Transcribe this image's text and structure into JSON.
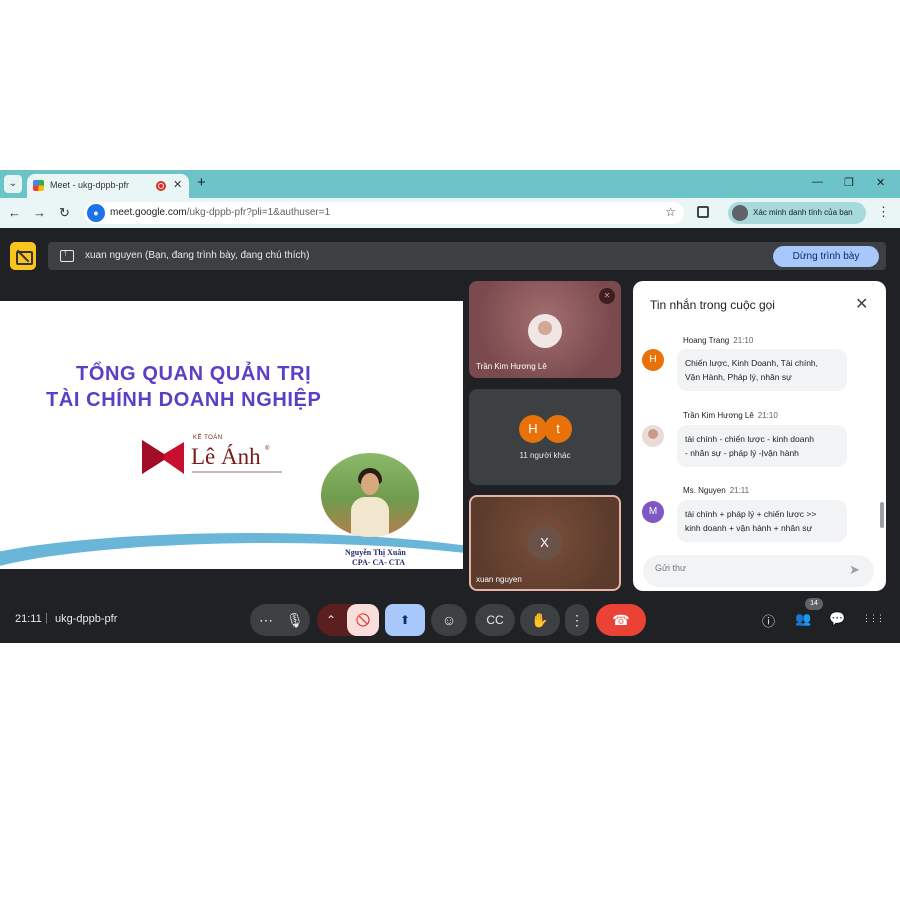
{
  "browser": {
    "tab_title": "Meet - ukg-dppb-pfr",
    "tab_close": "✕",
    "new_tab": "+",
    "url_host": "meet.google.com",
    "url_path": "/ukg-dppb-pfr?pli=1&authuser=1",
    "profile_chip": "Xác minh danh tính của bạn",
    "window_controls": [
      "—",
      "❐",
      "✕"
    ]
  },
  "presenting_bar": {
    "text": "xuan nguyen (Bạn, đang trình bày, đang chú thích)",
    "stop_button": "Dừng trình bày"
  },
  "slide": {
    "title_line1": "TỔNG QUAN QUẢN TRỊ",
    "title_line2": "TÀI CHÍNH DOANH NGHIỆP",
    "brand_kicker": "KẾ TOÁN",
    "brand_name": "Lê Ánh",
    "brand_reg": "®",
    "speaker_name": "Nguyễn Thị Xuân",
    "speaker_credentials": "CPA- CA- CTA"
  },
  "tiles": [
    {
      "label": "Trần Kim Hương Lê",
      "muted": true
    },
    {
      "label": "11 người khác",
      "initials": [
        "H",
        "t"
      ],
      "colors": [
        "#e8710a",
        "#e8710a"
      ]
    },
    {
      "label": "xuan nguyen",
      "initial": "X"
    }
  ],
  "chat": {
    "title": "Tin nhắn trong cuộc gọi",
    "messages": [
      {
        "sender": "Hoang Trang",
        "time": "21:10",
        "avatar": "H",
        "avatar_color": "#e8710a",
        "line1": "Chiến lược, Kinh Doanh, Tài chính,",
        "line2": "Vận Hành, Pháp lý, nhân sự"
      },
      {
        "sender": "Trần Kim Hương Lê",
        "time": "21:10",
        "avatar": "",
        "line1": "tài chính - chiến lược - kinh doanh",
        "line2": "- nhân sự - pháp lý -Ịvận hành"
      },
      {
        "sender": "Ms. Nguyen",
        "time": "21:11",
        "avatar": "M",
        "avatar_color": "#7e57c2",
        "line1": "tài chính + pháp lý + chiến lược >>",
        "line2": "kinh doanh + vận hành + nhân sự"
      }
    ],
    "input_placeholder": "Gửi thư"
  },
  "footer": {
    "time": "21:11",
    "separator": "|",
    "meeting_code": "ukg-dppb-pfr",
    "participant_count": "14"
  },
  "icons": {
    "more": "⋯",
    "mic": "🎙",
    "chevron_up": "⌃",
    "camera_off": "🚫",
    "present": "⬆",
    "emoji": "☺",
    "captions": "CC",
    "hand": "✋",
    "more_vert": "⋮",
    "leave": "☎",
    "info": "ⓘ",
    "people": "👥",
    "chat": "💬",
    "apps": "⋮⋮⋮",
    "send": "➤",
    "close": "✕",
    "star": "☆"
  },
  "colors": {
    "tab_strip": "#6cc4c8",
    "slide_title": "#5b3fc4",
    "brand_red": "#c8102e",
    "leave_red": "#ea4335",
    "present_blue": "#a8c7fa"
  }
}
